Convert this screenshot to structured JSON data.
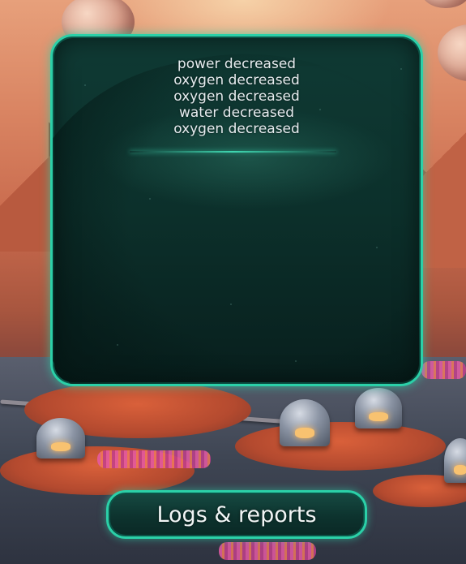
{
  "log_panel": {
    "entries": [
      "power decreased",
      "oxygen decreased",
      "oxygen decreased",
      "water decreased",
      "oxygen decreased"
    ]
  },
  "logs_button": {
    "label": "Logs & reports"
  },
  "colors": {
    "accent": "#2bd0a8",
    "panel_bg": "#0c302b",
    "text": "#e6ecef"
  }
}
